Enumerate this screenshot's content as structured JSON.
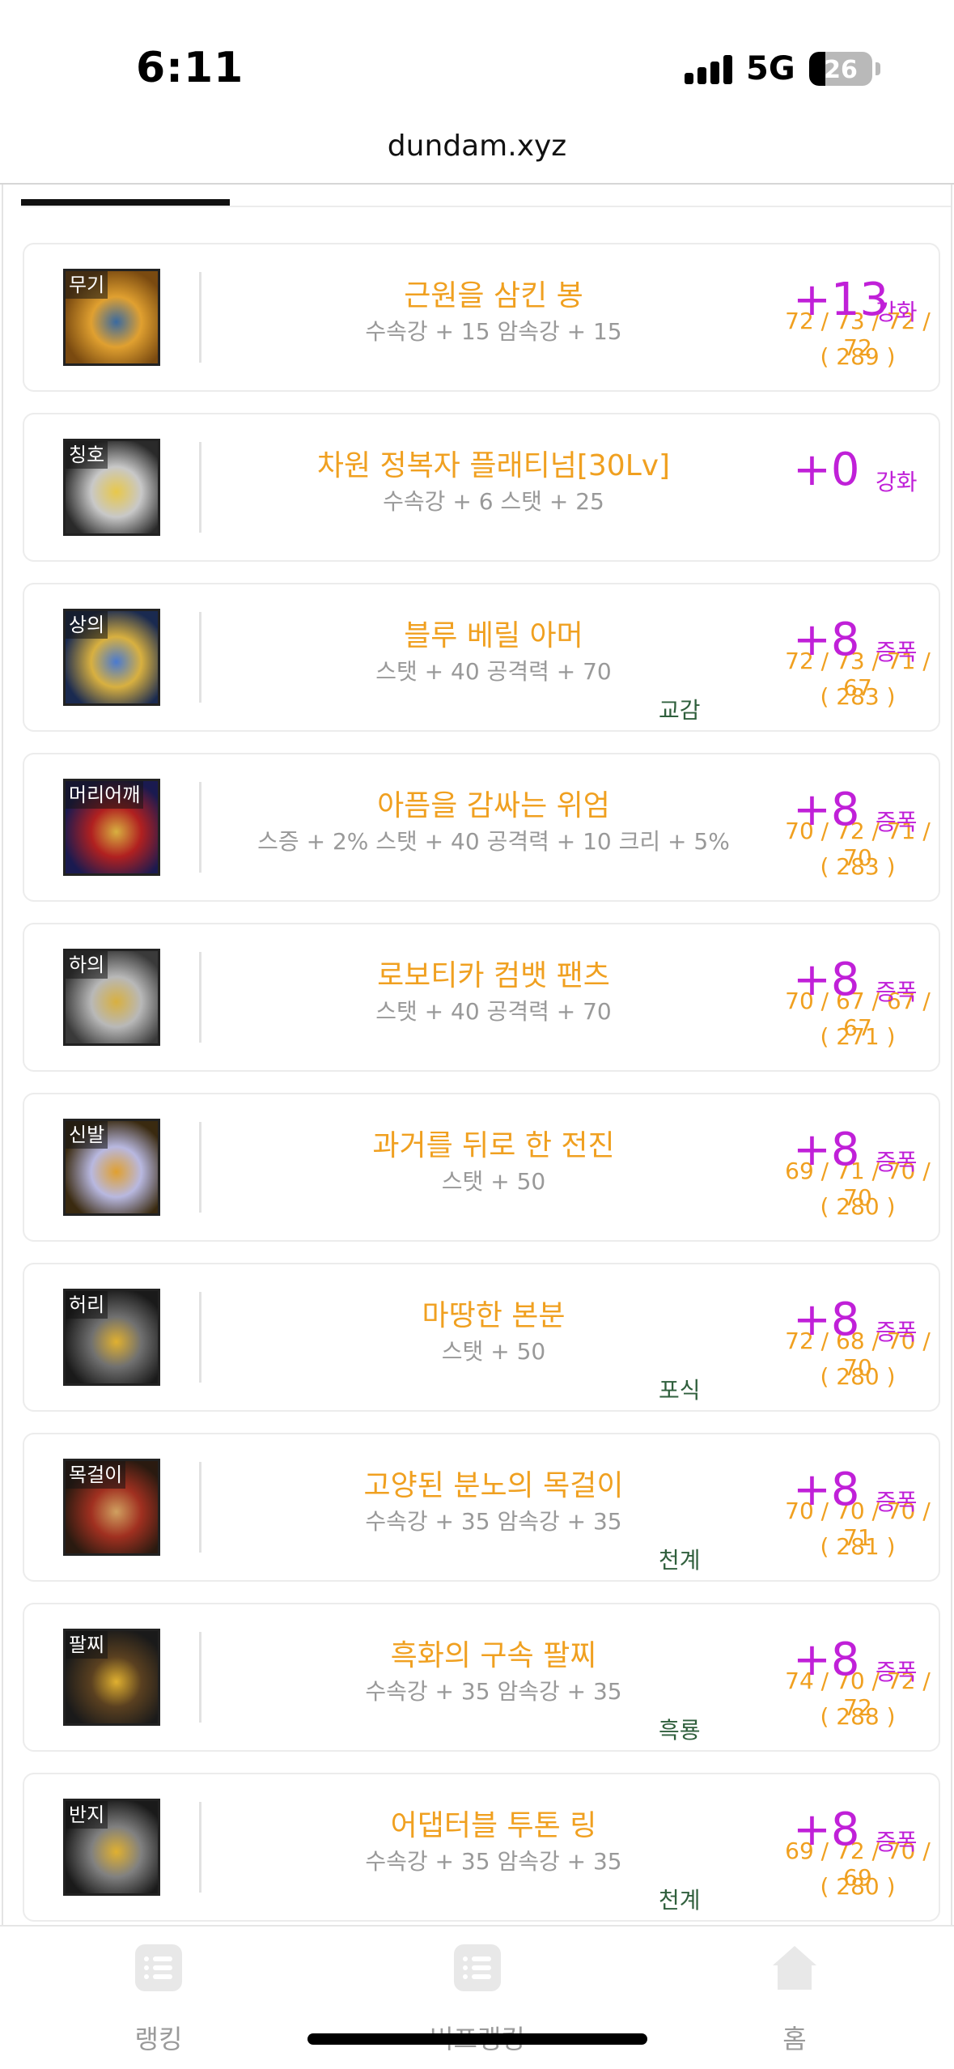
{
  "status": {
    "time": "6:11",
    "network": "5G",
    "battery": "26",
    "battery_level": 0.26
  },
  "browser": {
    "url": "dundam.xyz"
  },
  "items": [
    {
      "slot": "무기",
      "name": "근원을 삼킨 봉",
      "options": "수속강 + 15 암속강 + 15",
      "tag": "",
      "enhance": "+13",
      "enhance_type": "강화",
      "stats": "72 / 73 / 72 / 72",
      "stats_total": "( 289 )",
      "art": [
        "#7a4a10",
        "#e0a030",
        "#3a6aa0"
      ]
    },
    {
      "slot": "칭호",
      "name": "차원 정복자 플래티넘[30Lv]",
      "options": "수속강 + 6 스탯 + 25",
      "tag": "",
      "enhance": "+0",
      "enhance_type": "강화",
      "stats": "",
      "stats_total": "",
      "art": [
        "#2a2a2a",
        "#c8c8c8",
        "#e8c84a"
      ]
    },
    {
      "slot": "상의",
      "name": "블루 베릴 아머",
      "options": "스탯 + 40 공격력 + 70",
      "tag": "교감",
      "enhance": "+8",
      "enhance_type": "증폭",
      "stats": "72 / 73 / 71 / 67",
      "stats_total": "( 283 )",
      "art": [
        "#1a2a50",
        "#d8b040",
        "#4a7ad0"
      ]
    },
    {
      "slot": "머리어깨",
      "name": "아픔을 감싸는 위엄",
      "options": "스증 + 2% 스탯 + 40 공격력 + 10 크리 + 5%",
      "tag": "",
      "enhance": "+8",
      "enhance_type": "증폭",
      "stats": "70 / 72 / 71 / 70",
      "stats_total": "( 283 )",
      "art": [
        "#1a1a50",
        "#b02020",
        "#d8b040"
      ]
    },
    {
      "slot": "하의",
      "name": "로보티카 컴뱃 팬츠",
      "options": "스탯 + 40 공격력 + 70",
      "tag": "",
      "enhance": "+8",
      "enhance_type": "증폭",
      "stats": "70 / 67 / 67 / 67",
      "stats_total": "( 271 )",
      "art": [
        "#3a3a3a",
        "#b8b8b8",
        "#d8b040"
      ]
    },
    {
      "slot": "신발",
      "name": "과거를 뒤로 한 전진",
      "options": "스탯 + 50",
      "tag": "",
      "enhance": "+8",
      "enhance_type": "증폭",
      "stats": "69 / 71 / 70 / 70",
      "stats_total": "( 280 )",
      "art": [
        "#3a2a10",
        "#b8b8e0",
        "#e0a030"
      ]
    },
    {
      "slot": "허리",
      "name": "마땅한 본분",
      "options": "스탯 + 50",
      "tag": "포식",
      "enhance": "+8",
      "enhance_type": "증폭",
      "stats": "72 / 68 / 70 / 70",
      "stats_total": "( 280 )",
      "art": [
        "#1a1a1a",
        "#707070",
        "#e0b030"
      ]
    },
    {
      "slot": "목걸이",
      "name": "고양된 분노의 목걸이",
      "options": "수속강 + 35 암속강 + 35",
      "tag": "천계",
      "enhance": "+8",
      "enhance_type": "증폭",
      "stats": "70 / 70 / 70 / 71",
      "stats_total": "( 281 )",
      "art": [
        "#2a1a10",
        "#a03020",
        "#d0a060"
      ]
    },
    {
      "slot": "팔찌",
      "name": "흑화의 구속 팔찌",
      "options": "수속강 + 35 암속강 + 35",
      "tag": "흑룡",
      "enhance": "+8",
      "enhance_type": "증폭",
      "stats": "74 / 70 / 72 / 72",
      "stats_total": "( 288 )",
      "art": [
        "#1a1a1a",
        "#5a4020",
        "#e0b030"
      ]
    },
    {
      "slot": "반지",
      "name": "어댑터블 투톤 링",
      "options": "수속강 + 35 암속강 + 35",
      "tag": "천계",
      "enhance": "+8",
      "enhance_type": "증폭",
      "stats": "69 / 72 / 70 / 69",
      "stats_total": "( 280 )",
      "art": [
        "#1a1a1a",
        "#808080",
        "#e0b030"
      ]
    }
  ],
  "nav": [
    {
      "label": "랭킹",
      "icon": "list-icon"
    },
    {
      "label": "버프랭킹",
      "icon": "list-icon"
    },
    {
      "label": "홈",
      "icon": "home-icon"
    }
  ]
}
